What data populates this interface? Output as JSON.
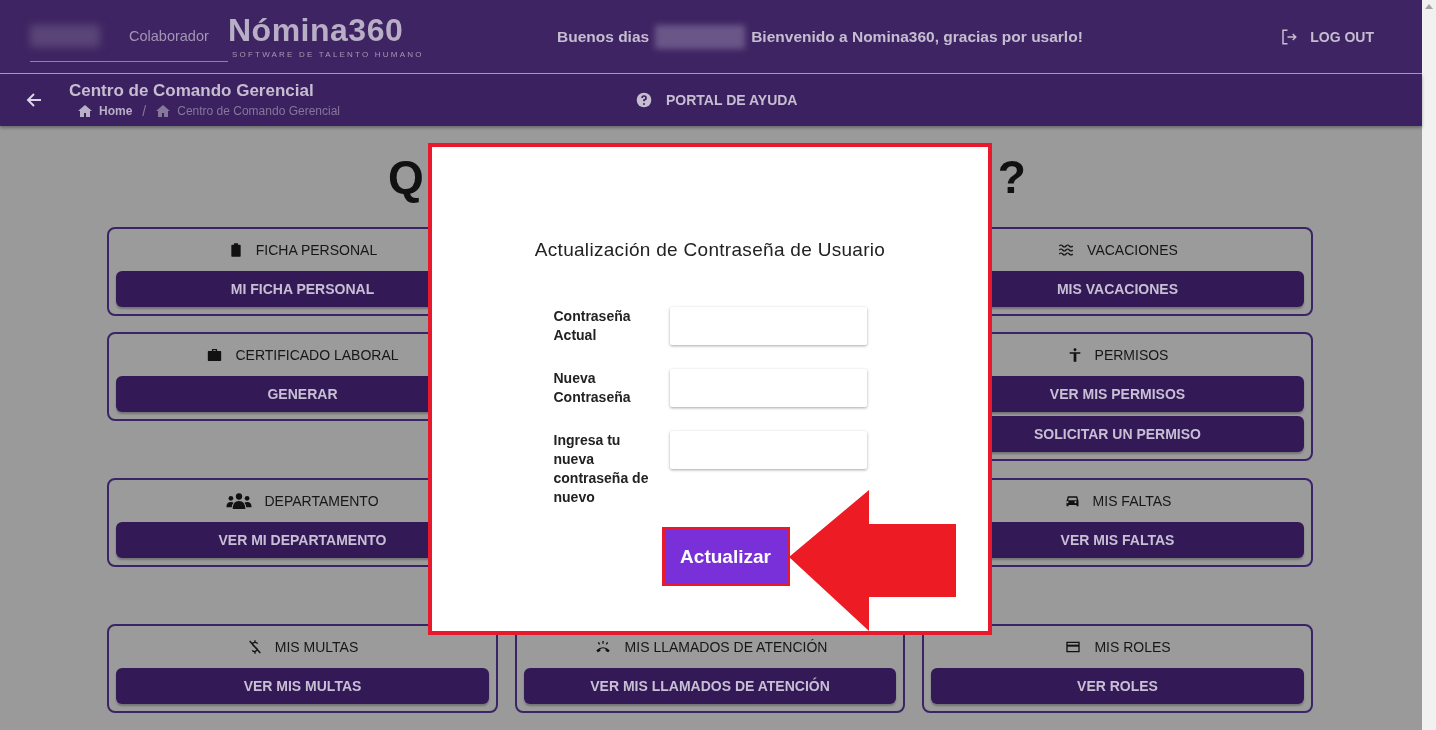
{
  "header": {
    "role_label": "Colaborador",
    "logo_name": "Nómina360",
    "logo_tagline": "SOFTWARE DE TALENTO HUMANO",
    "greeting_start": "Buenos dias",
    "greeting_end": "Bienvenido a Nomina360, gracias por usarlo!",
    "logout": "LOG OUT"
  },
  "subheader": {
    "title": "Centro de Comando Gerencial",
    "breadcrumb_separator": "/",
    "breadcrumb": [
      {
        "label": "Home",
        "selected": false
      },
      {
        "label": "Centro de Comando Gerencial",
        "selected": true
      }
    ],
    "help_link": "PORTAL DE AYUDA"
  },
  "page_heading": {
    "visible_start": "Q",
    "visible_end": "?"
  },
  "cards": [
    {
      "title": "FICHA PERSONAL",
      "buttons": [
        "MI FICHA PERSONAL"
      ]
    },
    {
      "title": "VACACIONES",
      "buttons": [
        "MIS VACACIONES"
      ]
    },
    {
      "title": "CERTIFICADO LABORAL",
      "buttons": [
        "GENERAR"
      ]
    },
    {
      "title": "PERMISOS",
      "buttons": [
        "VER MIS PERMISOS",
        "SOLICITAR UN PERMISO"
      ]
    },
    {
      "title": "DEPARTAMENTO",
      "buttons": [
        "VER MI DEPARTAMENTO"
      ]
    },
    {
      "title": "MIS FALTAS",
      "buttons": [
        "VER MIS FALTAS"
      ]
    },
    {
      "title": "MIS MULTAS",
      "buttons": [
        "VER MIS MULTAS"
      ]
    },
    {
      "title": "MIS LLAMADOS DE ATENCIÓN",
      "buttons": [
        "VER MIS LLAMADOS DE ATENCIÓN"
      ]
    },
    {
      "title": "MIS ROLES",
      "buttons": [
        "VER ROLES"
      ]
    }
  ],
  "modal": {
    "title": "Actualización de Contraseña de Usuario",
    "fields": [
      {
        "label": "Contraseña Actual"
      },
      {
        "label": "Nueva Contraseña"
      },
      {
        "label": "Ingresa tu nueva contraseña de nuevo"
      }
    ],
    "submit": "Actualizar"
  }
}
